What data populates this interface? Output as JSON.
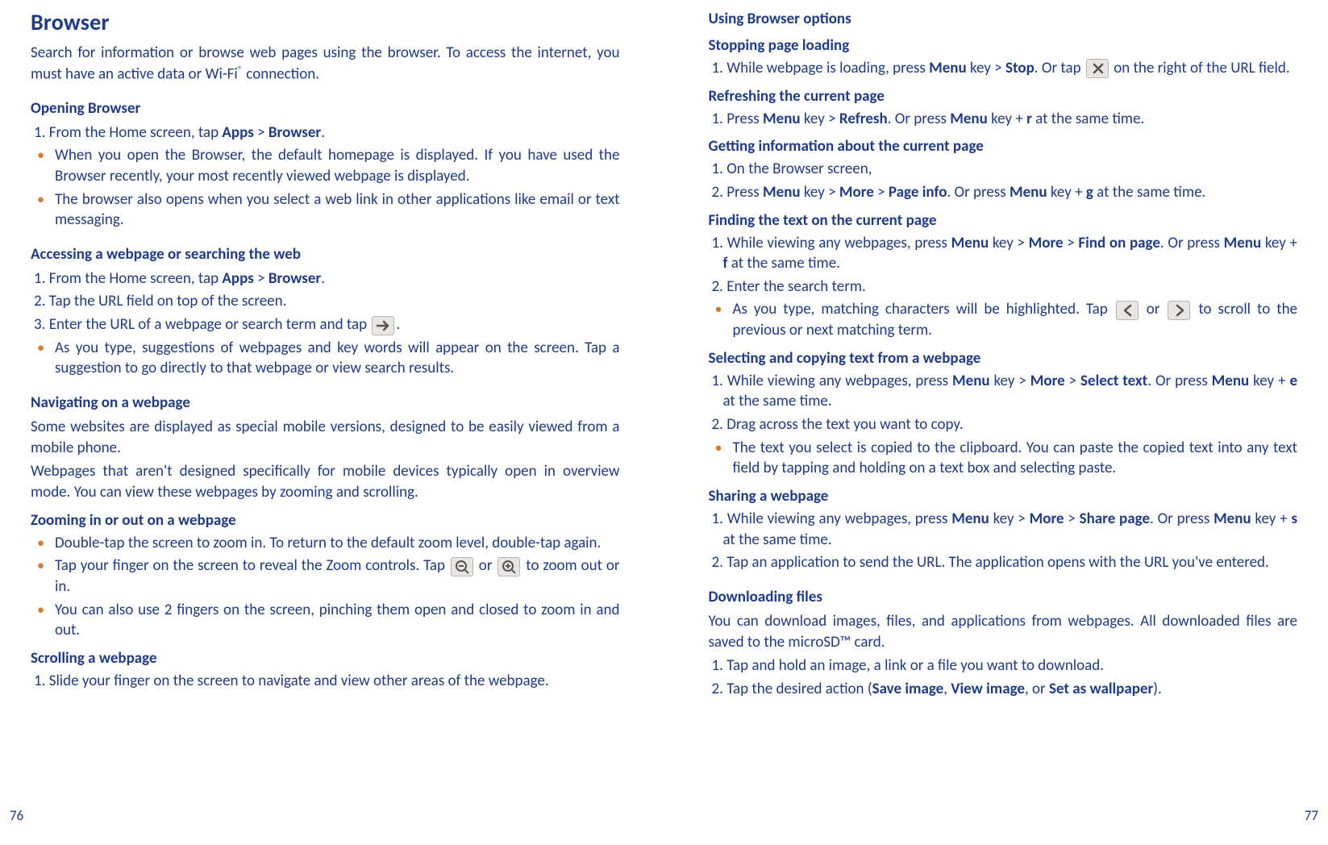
{
  "left": {
    "title": "Browser",
    "intro_parts": [
      "Search for information or browse web pages using the browser. To access the internet, you must have an active data or Wi-Fi",
      "®",
      " connection."
    ],
    "s1": {
      "h": "Opening Browser",
      "step1": [
        "1. From the Home screen, tap ",
        "Apps",
        " > ",
        "Browser",
        "."
      ],
      "b1": "When you open the Browser, the default homepage is displayed. If you have used the Browser recently, your most recently viewed webpage is displayed.",
      "b2": "The browser also opens when you select a web link in other applications like email or text messaging."
    },
    "s2": {
      "h": "Accessing a webpage or searching the web",
      "step1": [
        "1. From the Home screen, tap ",
        "Apps",
        " > ",
        "Browser",
        "."
      ],
      "step2": "2. Tap the URL field on top of the screen.",
      "step3_pre": "3. Enter the URL of a webpage or search term and tap ",
      "step3_post": ".",
      "b1": "As you type, suggestions of webpages and key words will appear on the screen. Tap a suggestion to go directly to that webpage or view search results."
    },
    "s3": {
      "h": "Navigating on a webpage",
      "p1": "Some websites are displayed as special mobile versions, designed to be easily viewed from a mobile phone.",
      "p2": "Webpages that aren't designed specifically for mobile devices typically open in overview mode. You can view these webpages by zooming and scrolling.",
      "sub1": "Zooming in or out on a webpage",
      "b1": "Double-tap the screen to zoom in. To return to the default zoom level, double-tap again.",
      "b2_pre": "Tap your finger on the screen to reveal the Zoom controls. Tap ",
      "b2_mid": " or ",
      "b2_post": " to zoom out or in.",
      "b3": "You can also use 2 fingers on the screen, pinching them open and closed to zoom in and out.",
      "sub2": "Scrolling a webpage",
      "scroll1": "1. Slide your finger on the screen to navigate and view other areas of the webpage."
    },
    "pagenum": "76"
  },
  "right": {
    "h1": "Using Browser options",
    "sub_stop": "Stopping page loading",
    "stop1_pre": "1. While webpage is loading, press ",
    "stop1_parts": [
      "Menu",
      " key > ",
      "Stop",
      ". Or tap "
    ],
    "stop1_post": " on the right of the URL field.",
    "sub_refresh": "Refreshing the current page",
    "refresh1": [
      "1. Press ",
      "Menu",
      " key > ",
      "Refresh",
      ". Or press ",
      "Menu",
      " key + ",
      "r",
      " at the same time."
    ],
    "sub_info": "Getting information about the current page",
    "info1": "1. On the Browser screen,",
    "info2": [
      "2. Press ",
      "Menu",
      " key > ",
      "More",
      " > ",
      "Page info",
      ". Or press ",
      "Menu",
      " key + ",
      "g",
      " at the same time."
    ],
    "sub_find": "Finding the text on the current page",
    "find1": [
      "1. While viewing any webpages, press ",
      "Menu",
      " key > ",
      "More",
      " > ",
      "Find on page",
      ". Or press ",
      "Menu",
      " key + ",
      "f",
      " at the same time."
    ],
    "find2": "2. Enter the search term.",
    "find_b1_pre": "As you type, matching characters will be highlighted. Tap ",
    "find_b1_mid": " or ",
    "find_b1_post": " to scroll to the previous or next matching term.",
    "sub_select": "Selecting and copying text from a webpage",
    "sel1": [
      "1. While viewing any webpages, press ",
      "Menu",
      " key > ",
      "More",
      " > ",
      "Select text",
      ". Or press ",
      "Menu",
      " key + ",
      "e",
      " at the same time."
    ],
    "sel2": "2. Drag across the text you want to copy.",
    "sel_b1": "The text you select is copied to the clipboard. You can paste the copied text into any text field by tapping and holding on a text box and selecting paste.",
    "sub_share": "Sharing a webpage",
    "share1": [
      "1. While viewing any webpages, press ",
      "Menu",
      " key > ",
      "More",
      " > ",
      "Share page",
      ". Or press ",
      "Menu",
      " key + ",
      "s",
      " at the same time."
    ],
    "share2": "2. Tap an application to send the URL. The application opens with the URL you've entered.",
    "h_dl": "Downloading files",
    "dl_p": "You can download images, files, and applications from webpages. All downloaded files are saved to the microSD™ card.",
    "dl1": "1. Tap and hold an image, a link or a file you want to download.",
    "dl2": [
      "2. Tap the desired action (",
      "Save image",
      ", ",
      "View image",
      ", or ",
      "Set as wallpaper",
      ")."
    ],
    "pagenum": "77"
  }
}
